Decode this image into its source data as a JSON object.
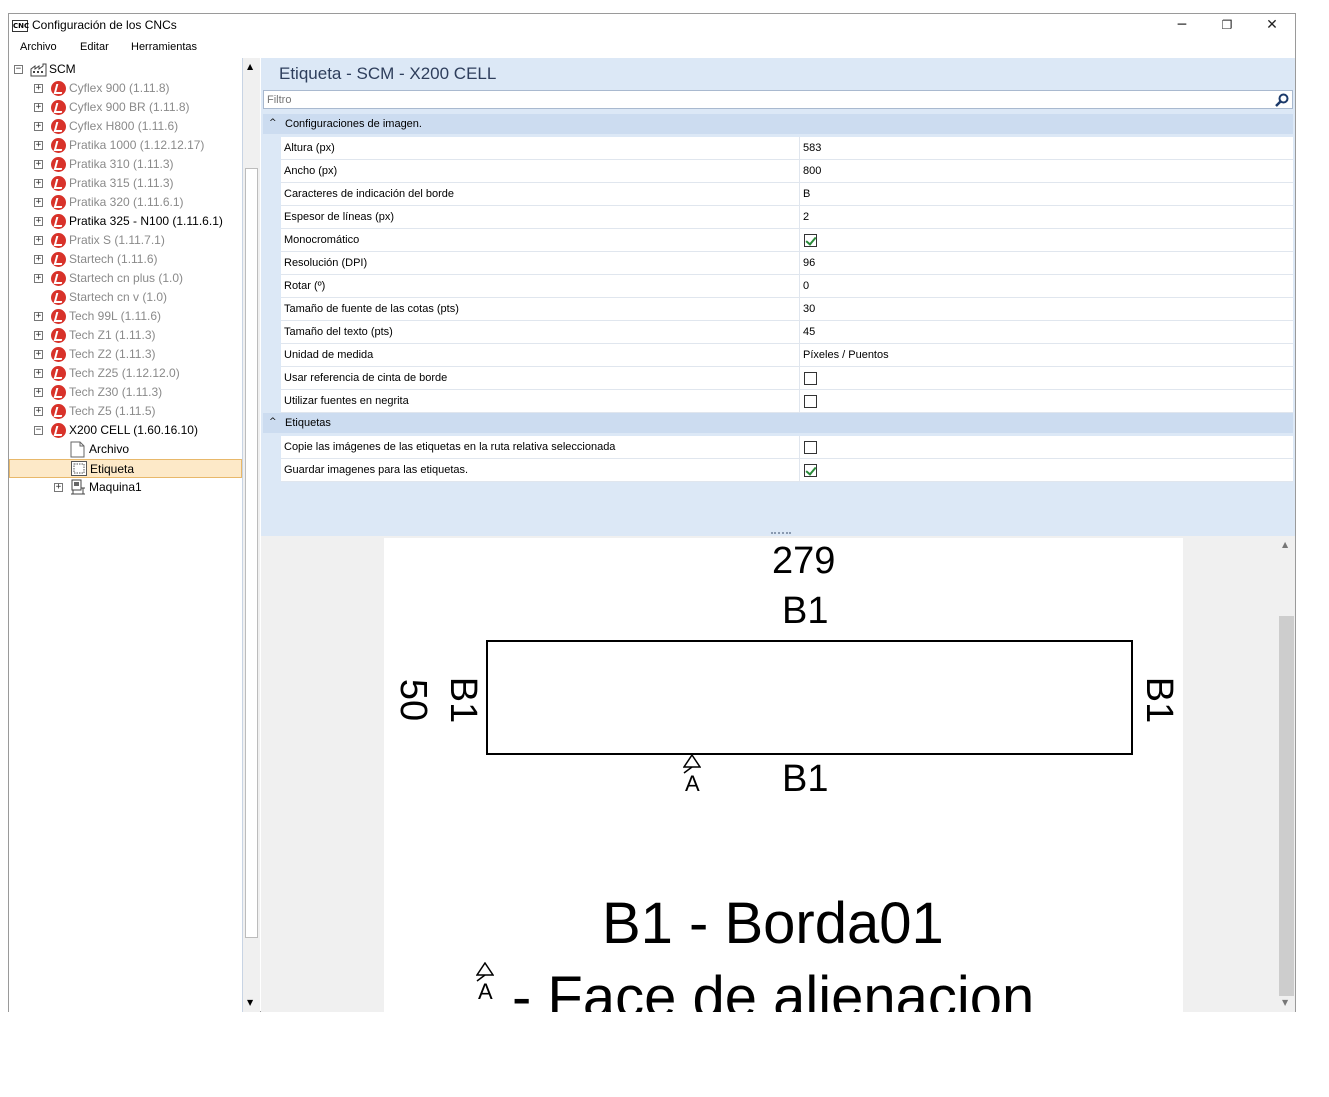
{
  "window": {
    "title": "Configuración de los CNCs",
    "icon_text": "CNC",
    "controls": {
      "minimize": "─",
      "maximize": "❐",
      "close": "✕"
    }
  },
  "menu": [
    "Archivo",
    "Editar",
    "Herramientas"
  ],
  "tree": {
    "root": "SCM",
    "items": [
      {
        "label": "Cyflex 900 (1.11.8)",
        "dim": true,
        "expander": true
      },
      {
        "label": "Cyflex 900 BR (1.11.8)",
        "dim": true,
        "expander": true
      },
      {
        "label": "Cyflex H800 (1.11.6)",
        "dim": true,
        "expander": true
      },
      {
        "label": "Pratika 1000 (1.12.12.17)",
        "dim": true,
        "expander": true
      },
      {
        "label": "Pratika 310 (1.11.3)",
        "dim": true,
        "expander": true
      },
      {
        "label": "Pratika 315 (1.11.3)",
        "dim": true,
        "expander": true
      },
      {
        "label": "Pratika 320 (1.11.6.1)",
        "dim": true,
        "expander": true
      },
      {
        "label": "Pratika 325 - N100 (1.11.6.1)",
        "dim": false,
        "expander": true
      },
      {
        "label": "Pratix S (1.11.7.1)",
        "dim": true,
        "expander": true
      },
      {
        "label": "Startech (1.11.6)",
        "dim": true,
        "expander": true
      },
      {
        "label": "Startech cn plus (1.0)",
        "dim": true,
        "expander": true
      },
      {
        "label": "Startech cn v (1.0)",
        "dim": true,
        "expander": false
      },
      {
        "label": "Tech 99L (1.11.6)",
        "dim": true,
        "expander": true
      },
      {
        "label": "Tech Z1 (1.11.3)",
        "dim": true,
        "expander": true
      },
      {
        "label": "Tech Z2 (1.11.3)",
        "dim": true,
        "expander": true
      },
      {
        "label": "Tech Z25 (1.12.12.0)",
        "dim": true,
        "expander": true
      },
      {
        "label": "Tech Z30 (1.11.3)",
        "dim": true,
        "expander": true
      },
      {
        "label": "Tech Z5 (1.11.5)",
        "dim": true,
        "expander": true
      },
      {
        "label": "X200 CELL (1.60.16.10)",
        "dim": false,
        "expander": true
      }
    ],
    "children": [
      "Archivo",
      "Etiqueta",
      "Maquina1"
    ]
  },
  "panel": {
    "title": "Etiqueta - SCM - X200 CELL",
    "filter_placeholder": "Filtro"
  },
  "grid": {
    "categories": [
      "Configuraciones de imagen.",
      "Etiquetas"
    ],
    "image_props": [
      {
        "name": "Altura (px)",
        "value": "583"
      },
      {
        "name": "Ancho (px)",
        "value": "800"
      },
      {
        "name": "Caracteres de indicación del borde",
        "value": "B"
      },
      {
        "name": "Espesor de líneas (px)",
        "value": "2"
      },
      {
        "name": "Monocromático",
        "check": true
      },
      {
        "name": "Resolución (DPI)",
        "value": "96"
      },
      {
        "name": "Rotar (º)",
        "value": "0"
      },
      {
        "name": "Tamaño de fuente de las cotas (pts)",
        "value": "30"
      },
      {
        "name": "Tamaño del texto (pts)",
        "value": "45"
      },
      {
        "name": "Unidad de medida",
        "value": "Píxeles / Puentos"
      },
      {
        "name": "Usar referencia de cinta de borde",
        "check": false
      },
      {
        "name": "Utilizar fuentes en negrita",
        "check": false
      }
    ],
    "label_props": [
      {
        "name": "Copie las imágenes de las etiquetas en la ruta relativa seleccionada",
        "check": false
      },
      {
        "name": "Guardar imagenes para las etiquetas.",
        "check": true
      }
    ]
  },
  "preview": {
    "dim_top": "279",
    "edge_top": "B1",
    "edge_left": "B1",
    "dim_left": "50",
    "edge_right": "B1",
    "edge_bottom": "B1",
    "face_marker": "A",
    "legend_edge": "B1 - Borda01",
    "legend_face": "- Face de alienacion"
  },
  "colors": {
    "accent": "#d8322a",
    "panel_bg": "#dce8f6",
    "category_bg": "#ccdcf0",
    "selection": "#fde9c8"
  }
}
